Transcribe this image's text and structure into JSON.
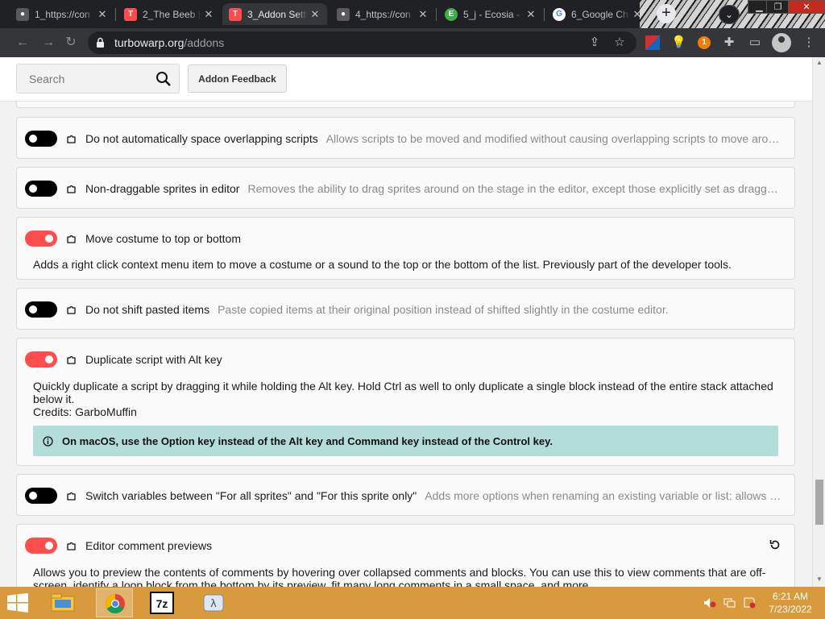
{
  "browser": {
    "tabs": [
      {
        "title": "1_https://con",
        "icon": "scratch-cat-icon",
        "active": false
      },
      {
        "title": "2_The Beeb | ",
        "icon": "turbowarp-icon",
        "active": false
      },
      {
        "title": "3_Addon Setti",
        "icon": "turbowarp-icon",
        "active": true
      },
      {
        "title": "4_https://con",
        "icon": "scratch-cat-icon",
        "active": false
      },
      {
        "title": "5_j - Ecosia -",
        "icon": "ecosia-icon",
        "active": false
      },
      {
        "title": "6_Google Chr",
        "icon": "google-icon",
        "active": false
      }
    ],
    "new_tab_symbol": "+",
    "url_domain": "turbowarp.org",
    "url_path": "/addons",
    "extension_badge": "1"
  },
  "page": {
    "search_placeholder": "Search",
    "feedback_label": "Addon Feedback",
    "addons": [
      {
        "name": "Do not automatically space overlapping scripts",
        "description": "Allows scripts to be moved and modified without causing overlapping scripts to move around.",
        "enabled": false
      },
      {
        "name": "Non-draggable sprites in editor",
        "description": "Removes the ability to drag sprites around on the stage in the editor, except those explicitly set as draggable.",
        "enabled": false
      },
      {
        "name": "Move costume to top or bottom",
        "description": "Adds a right click context menu item to move a costume or a sound to the top or the bottom of the list. Previously part of the developer tools.",
        "enabled": true
      },
      {
        "name": "Do not shift pasted items",
        "description": "Paste copied items at their original position instead of shifted slightly in the costume editor.",
        "enabled": false
      },
      {
        "name": "Duplicate script with Alt key",
        "description": "Quickly duplicate a script by dragging it while holding the Alt key. Hold Ctrl as well to only duplicate a single block instead of the entire stack attached below it.",
        "credits_label": "Credits:",
        "credits_name": "GarboMuffin",
        "notice": "On macOS, use the Option key instead of the Alt key and Command key instead of the Control key.",
        "enabled": true
      },
      {
        "name": "Switch variables between \"For all sprites\" and \"For this sprite only\"",
        "description": "Adds more options when renaming an existing variable or list: allows switching between \"For all sprites\" and \"For this sprite only\".",
        "enabled": false
      },
      {
        "name": "Editor comment previews",
        "description": "Allows you to preview the contents of comments by hovering over collapsed comments and blocks. You can use this to view comments that are off-screen, identify a loop block from the bottom by its preview, fit many long comments in a small space, and more.",
        "enabled": true
      }
    ]
  },
  "taskbar": {
    "time": "6:21 AM",
    "date": "7/23/2022",
    "apps": [
      "file-explorer-icon",
      "chrome-icon",
      "7zip-icon",
      "lambda-app-icon"
    ]
  },
  "colors": {
    "toggle_on": "#ff4c4c",
    "toggle_off": "#000000",
    "notice_bg": "#b4dcd9",
    "taskbar": "#d89a3c"
  }
}
